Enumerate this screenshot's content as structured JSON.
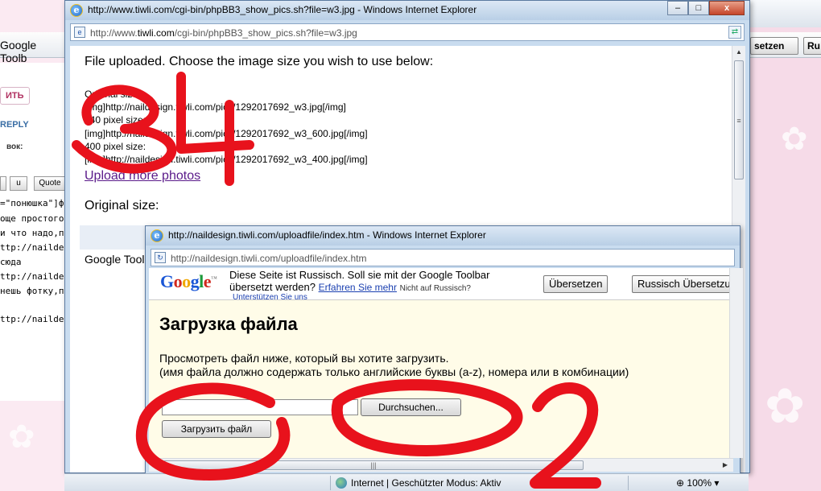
{
  "background_page": {
    "toolbar_text": "Google Toolb",
    "button_write": "ИТЬ",
    "reply": "REPLY",
    "label": "вок:",
    "fmt_u": "u",
    "fmt_quote": "Quote",
    "lines": [
      "=\"понюшка\"]ф",
      "още простого",
      "и что надо,по",
      "ttp://naildesi",
      "сюда",
      "ttp://naildesi",
      "нешь фотку,п",
      "ttp://naildesi"
    ],
    "button_write_2": "ИТЬ",
    "reply_2": "REPLY",
    "label_2": "вок:",
    "fmt_u_2": "u",
    "fmt_quote_2": "Quo",
    "lines_2": [
      "=\"понюшка\"]",
      "още просто",
      "и что надо"
    ],
    "right_button_1": "setzen",
    "right_button_2": "Ru"
  },
  "window1": {
    "title": "http://www.tiwli.com/cgi-bin/phpBB3_show_pics.sh?file=w3.jpg - Windows Internet Explorer",
    "address_prefix": "http://www.",
    "address_domain": "tiwli.com",
    "address_path": "/cgi-bin/phpBB3_show_pics.sh?file=w3.jpg",
    "controls": {
      "minimize": "–",
      "maximize": "□",
      "close": "x"
    },
    "heading": "File uploaded. Choose the image size you wish to use below:",
    "original_label": "Original size:",
    "original_code": "[img]http://naildesign.tiwli.com/pics/1292017692_w3.jpg[/img]",
    "size640_label": "640 pixel size:",
    "size640_code": "[img]http://naildesign.tiwli.com/pics/1292017692_w3_600.jpg[/img]",
    "size400_label": "400 pixel size:",
    "size400_code": "[img]http://naildesign.tiwli.com/pics/1292017692_w3_400.jpg[/img]",
    "upload_more": "Upload more photos",
    "original_size_big": "Original size:",
    "google_toolbar_partial": "Google Tool"
  },
  "window2": {
    "title": "http://naildesign.tiwli.com/uploadfile/index.htm - Windows Internet Explorer",
    "address": "http://naildesign.tiwli.com/uploadfile/index.htm",
    "translate_bar": {
      "line1": "Diese Seite ist Russisch. Soll sie mit der Google Toolbar",
      "line2": "übersetzt werden?",
      "learn_more": "Erfahren Sie mehr",
      "not_russian": "Nicht auf Russisch?",
      "support": "Unterstützen Sie uns",
      "translate_button": "Übersetzen",
      "russian_button": "Russisch Übersetzun"
    },
    "upload_title": "Загрузка файла",
    "desc1": "Просмотреть файл ниже, который вы хотите загрузить.",
    "desc2": "(имя файла должно содержать только английские буквы (a-z), номера или в комбинации)",
    "browse_button": "Durchsuchen...",
    "upload_button": "Загрузить файл"
  },
  "statusbar": {
    "zone": "Internet | Geschützter Modus: Aktiv",
    "zoom": "100%"
  },
  "annotations": {
    "left_top": "34",
    "right_bottom": "2"
  },
  "colors": {
    "scribble": "#e8121c",
    "link_visited": "#5a1a8a",
    "link": "#1a3fb0"
  }
}
